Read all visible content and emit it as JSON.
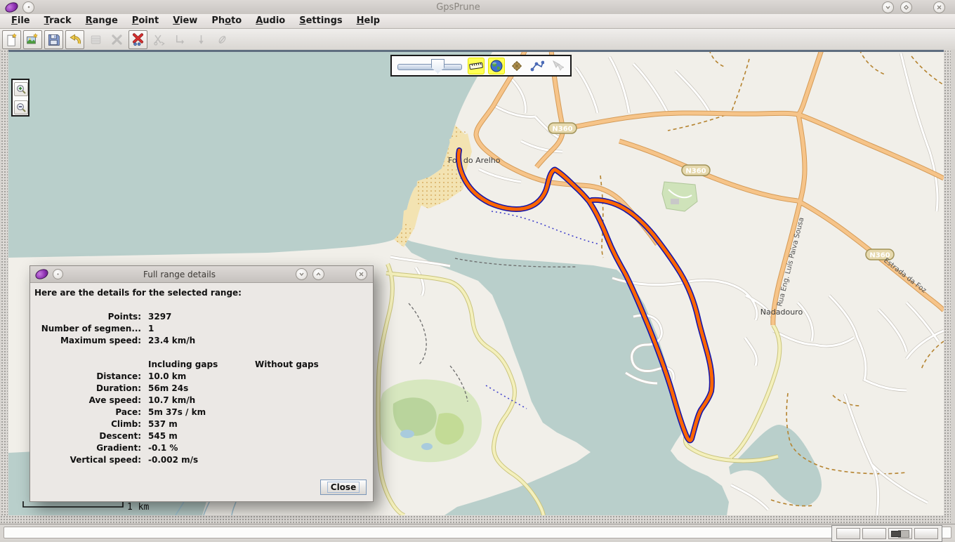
{
  "window": {
    "title": "GpsPrune",
    "buttons": [
      "minimize",
      "maximize",
      "close"
    ]
  },
  "menu": {
    "items": [
      {
        "pre": "",
        "key": "F",
        "post": "ile"
      },
      {
        "pre": "",
        "key": "T",
        "post": "rack"
      },
      {
        "pre": "",
        "key": "R",
        "post": "ange"
      },
      {
        "pre": "",
        "key": "P",
        "post": "oint"
      },
      {
        "pre": "",
        "key": "V",
        "post": "iew"
      },
      {
        "pre": "Ph",
        "key": "o",
        "post": "to"
      },
      {
        "pre": "",
        "key": "A",
        "post": "udio"
      },
      {
        "pre": "",
        "key": "S",
        "post": "ettings"
      },
      {
        "pre": "",
        "key": "H",
        "post": "elp"
      }
    ]
  },
  "toolbar": {
    "buttons": [
      {
        "icon": "open-file-icon",
        "enabled": true
      },
      {
        "icon": "add-photo-icon",
        "enabled": true
      },
      {
        "icon": "save-file-icon",
        "enabled": true
      },
      {
        "icon": "undo-icon",
        "enabled": true
      },
      {
        "icon": "edit-point-icon",
        "enabled": false
      },
      {
        "icon": "delete-point-icon",
        "enabled": false
      },
      {
        "icon": "delete-range-icon",
        "enabled": true
      },
      {
        "icon": "cut-move-range-icon",
        "enabled": false
      },
      {
        "icon": "append-range-icon",
        "enabled": false
      },
      {
        "icon": "reverse-range-icon",
        "enabled": false
      },
      {
        "icon": "connect-photo-icon",
        "enabled": false
      }
    ]
  },
  "map_toolbar": {
    "tools": [
      "zoom-slider",
      "scale-bar-toggle",
      "map-background-toggle",
      "autopan-toggle",
      "connect-points-toggle",
      "multi-select-tool"
    ],
    "active": [
      "scale-bar-toggle",
      "map-background-toggle"
    ]
  },
  "map": {
    "labels": {
      "town1": "Foz do Arelho",
      "town2": "Nadadouro",
      "road_badge": "N360",
      "street1": "Rua Eng. Luís Paiva Sousa",
      "street2": "Estrada da Foz",
      "scale": "1 km"
    },
    "colors": {
      "water": "#b9cfcb",
      "land": "#f1efe9",
      "sand": "#f3e3b2",
      "road_primary": "#f6c489",
      "road_yellow": "#f4f0bc",
      "green": "#c0d8a8",
      "track_core": "#ff6600",
      "track_casing": "#1616a8"
    }
  },
  "dialog": {
    "title": "Full range details",
    "heading": "Here are the details for the selected range:",
    "summary_rows": [
      {
        "label": "Points:",
        "value": "3297"
      },
      {
        "label": "Number of segmen...",
        "value": "1"
      },
      {
        "label": "Maximum speed:",
        "value": "23.4 km/h"
      }
    ],
    "columns": {
      "col1": "Including gaps",
      "col2": "Without gaps"
    },
    "detail_rows": [
      {
        "label": "Distance:",
        "value": "10.0 km"
      },
      {
        "label": "Duration:",
        "value": "56m 24s"
      },
      {
        "label": "Ave speed:",
        "value": "10.7 km/h"
      },
      {
        "label": "Pace:",
        "value": "5m 37s / km"
      },
      {
        "label": "Climb:",
        "value": "537 m"
      },
      {
        "label": "Descent:",
        "value": "545 m"
      },
      {
        "label": "Gradient:",
        "value": "-0.1 %"
      },
      {
        "label": "Vertical speed:",
        "value": "-0.002 m/s"
      }
    ],
    "close_label": "Close"
  }
}
